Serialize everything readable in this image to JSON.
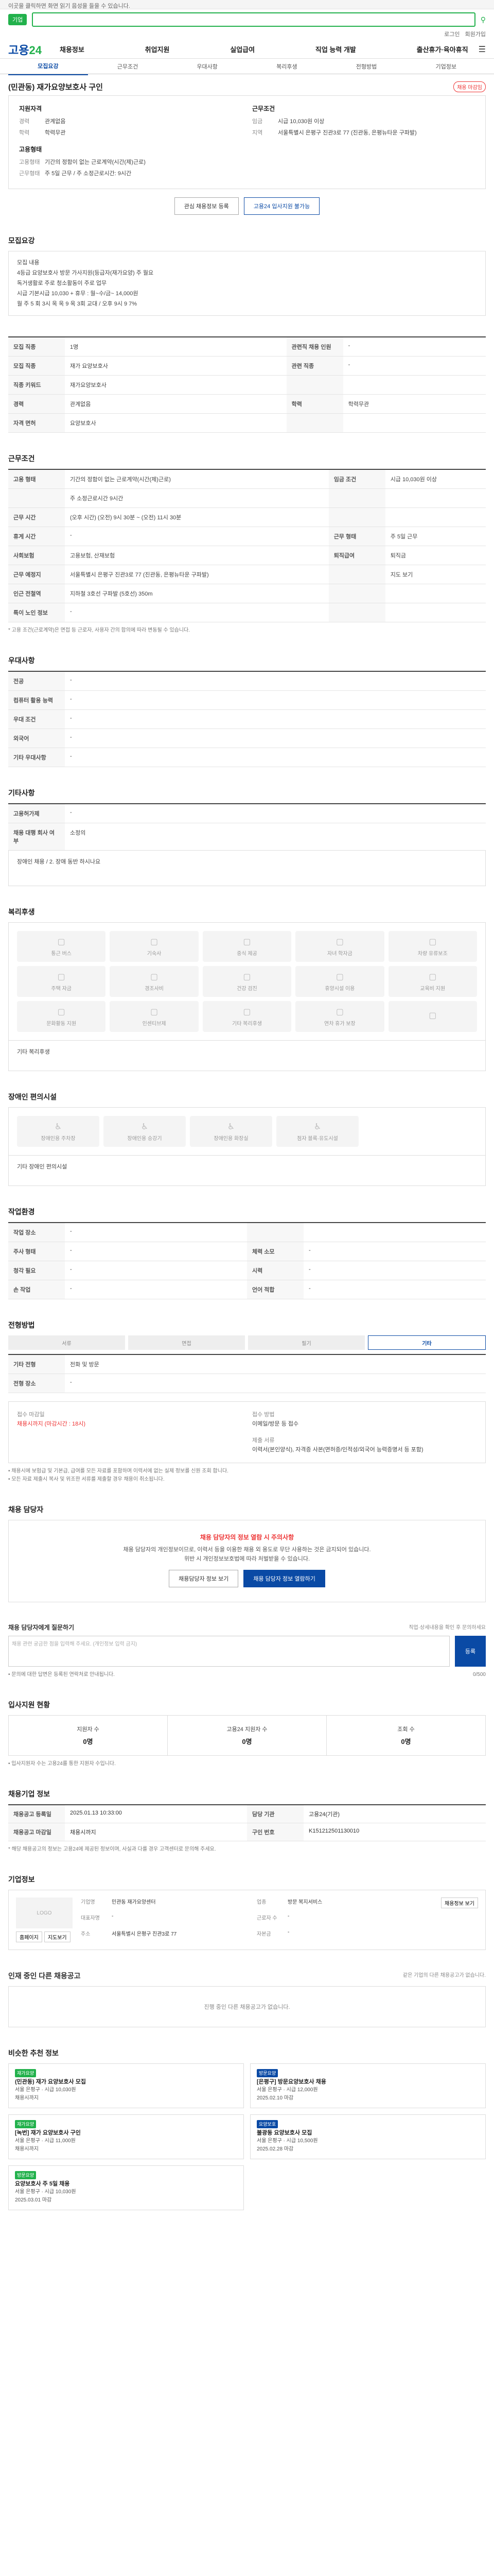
{
  "topbar": {
    "text": "이곳을 클릭하면 화면 읽기 음성을 들을 수 있습니다."
  },
  "search": {
    "filter": "기업"
  },
  "util": {
    "login": "로그인",
    "join": "회원가입"
  },
  "logo": {
    "part1": "고용",
    "part2": "24"
  },
  "gnb": [
    "채용정보",
    "취업지원",
    "실업급여",
    "직업 능력 개발",
    "출산휴가·육아휴직"
  ],
  "tabs": [
    "모집요강",
    "근무조건",
    "우대사항",
    "복리후생",
    "전형방법",
    "기업정보"
  ],
  "job": {
    "title": "(민관동) 재가요양보호사 구인",
    "badge": "채용 마감임",
    "summary": {
      "recruit_head": "지원자격",
      "recruit": [
        {
          "k": "경력",
          "v": "관계없음"
        },
        {
          "k": "학력",
          "v": "학력무관"
        }
      ],
      "work_head": "근무조건",
      "work": [
        {
          "k": "임금",
          "v": "시급 10,030원 이상"
        },
        {
          "k": "지역",
          "v": "서울특별시 은평구 진관3로 77 (진관동, 은평뉴타운 구파발)"
        }
      ],
      "emp_head": "고용형태",
      "emp": [
        {
          "k": "고용형태",
          "v": "기간의 정함이 없는 근로계약(시간(제)근로)"
        },
        {
          "k": "근무형태",
          "v": "주 5일 근무 / 주 소정근로시간: 9시간"
        }
      ]
    },
    "btn_scrap": "관심 채용정보 등록",
    "btn_apply": "고용24 입사지원 불가능"
  },
  "recruit_section": {
    "title": "모집요강",
    "desc_lines": [
      "모집 내용",
      "4등급 요양보호사 방문 가사지원(등급자(재가요양) 주 월요",
      "독거생활로 주로 청소활동이 주로 업무",
      "시급 기본시급 10,030 + 휴무 : 월~수/금~ 14,000원",
      "월 주 5 회 3시 옥 옥 9 옥 3회 교대 / 오후 9시 9 7%"
    ],
    "rows": [
      [
        {
          "k": "모집 직종",
          "v": "1명"
        },
        {
          "k": "관련직 채용 인원",
          "v": "-"
        }
      ],
      [
        {
          "k": "모집 직종",
          "v": "재가 요양보호사"
        },
        {
          "k": "관련 직종",
          "v": "-"
        }
      ],
      [
        {
          "k": "직종 키워드",
          "v": "재가요양보호사"
        },
        {
          "k": "",
          "v": ""
        }
      ],
      [
        {
          "k": "경력",
          "v": "관계없음"
        },
        {
          "k": "학력",
          "v": "학력무관"
        }
      ],
      [
        {
          "k": "자격 면허",
          "v": "요양보호사"
        },
        {
          "k": "",
          "v": ""
        }
      ]
    ]
  },
  "work_section": {
    "title": "근무조건",
    "rows": [
      [
        {
          "k": "고용 형태",
          "v": "기간의 정함이 없는 근로계약(시간(제)근로)"
        },
        {
          "k": "임금 조건",
          "v": "시급 10,030원 이상"
        }
      ],
      [
        {
          "k": "",
          "v": "주 소정근로시간 9시간"
        },
        {
          "k": "",
          "v": ""
        }
      ],
      [
        {
          "k": "근무 시간",
          "v": "(오후 시간) (오전) 9시 30분 ~ (오전) 11시 30분"
        },
        {
          "k": "",
          "v": ""
        }
      ],
      [
        {
          "k": "휴게 시간",
          "v": "-"
        },
        {
          "k": "근무 형태",
          "v": "주 5일 근무"
        }
      ],
      [
        {
          "k": "사회보험",
          "v": "고용보험, 산재보험"
        },
        {
          "k": "퇴직급여",
          "v": "퇴직금"
        }
      ],
      [
        {
          "k": "근무 예정지",
          "v": "서울특별시 은평구 진관3로 77 (진관동, 은평뉴타운 구파발)"
        },
        {
          "k": "",
          "v": "지도 보기"
        }
      ],
      [
        {
          "k": "인근 전철역",
          "v": "지하철 3호선 구파발 (5호선) 350m"
        },
        {
          "k": "",
          "v": ""
        }
      ],
      [
        {
          "k": "특이 노인 정보",
          "v": "-"
        },
        {
          "k": "",
          "v": ""
        }
      ]
    ],
    "note": "* 고용 조건(근로계약)은 면접 등 근로자, 사용자 간의 합의에 따라 변동될 수 있습니다."
  },
  "pref_section": {
    "title": "우대사항",
    "rows": [
      {
        "k": "전공",
        "v": "-"
      },
      {
        "k": "컴퓨터 활용 능력",
        "v": "-"
      },
      {
        "k": "우대 조건",
        "v": "-"
      },
      {
        "k": "외국어",
        "v": "-"
      },
      {
        "k": "기타 우대사항",
        "v": "-"
      }
    ]
  },
  "other_section": {
    "title": "기타사항",
    "rows": [
      {
        "k": "고용허가제",
        "v": "-"
      },
      {
        "k": "채용 대행 회사 여부",
        "v": "소정의"
      }
    ],
    "sub": "장애인 채용 / 2. 장애 동반 하시나요"
  },
  "welfare_section": {
    "title": "복리후생",
    "items": [
      "통근 버스",
      "기숙사",
      "중식 제공",
      "자녀 학자금",
      "차량 유류보조",
      "주택 자금",
      "경조사비",
      "건강 검진",
      "휴양시설 이용",
      "교육비 지원",
      "문화활동 지원",
      "인센티브제",
      "기타 복리후생",
      "연차 휴가 보장",
      ""
    ],
    "etc": "기타 복리후생"
  },
  "disabled_section": {
    "title": "장애인 편의시설",
    "items": [
      "장애인용 주차장",
      "장애인용 승강기",
      "장애인용 화장실",
      "점자 블록·유도시설"
    ],
    "etc": "기타 장애인 편의시설"
  },
  "env_section": {
    "title": "작업환경",
    "rows": [
      [
        {
          "k": "작업 장소",
          "v": "-"
        },
        {
          "k": "",
          "v": ""
        }
      ],
      [
        {
          "k": "주사 형태",
          "v": "-"
        },
        {
          "k": "체력 소모",
          "v": "-"
        }
      ],
      [
        {
          "k": "청각 필요",
          "v": "-"
        },
        {
          "k": "시력",
          "v": "-"
        }
      ],
      [
        {
          "k": "손 작업",
          "v": "-"
        },
        {
          "k": "언어 적합",
          "v": "-"
        }
      ]
    ]
  },
  "process_section": {
    "title": "전형방법",
    "steps": [
      "서류",
      "면접",
      "필기",
      "기타"
    ],
    "rows": [
      {
        "k": "기타 전형",
        "v": "전화 및 방문"
      },
      {
        "k": "전형 장소",
        "v": "-"
      }
    ],
    "apply": {
      "head1": "접수 마감일",
      "val1": "채용시까지 (마감시간 : 18시)",
      "head2": "접수 방법",
      "val2": "이메일/방문 등 접수",
      "head3": "제출 서류",
      "val3": "이력서(본인양식), 자격증 사본(면허증/인적성/외국어 능력증명서 등 포함)"
    },
    "notes": [
      "• 채용시에 보험급 및 기본급, 급여를 모든 자료를 포함하며 이력서에 없는 실제 정보를 신원 조회 합니다.",
      "• 모든 자료 제출시 복사 및 위조한 서류를 제출할 경우 채용이 취소됩니다."
    ]
  },
  "contact_section": {
    "title": "채용 담당자",
    "notice_title": "채용 담당자의 정보 열람 시 주의사항",
    "notice_lines": [
      "채용 담당자의 개인정보이므로, 이력서 등을 이용한 채용 외 용도로 무단 사용하는 것은 금지되어 있습니다.",
      "위반 시 개인정보보호법에 따라 처벌받을 수 있습니다."
    ],
    "btn_detail": "채용담당자 정보 보기",
    "btn_view": "채용 담당자 정보 열람하기"
  },
  "qna_section": {
    "title": "채용 담당자에게 질문하기",
    "hint": "직업·상세내용을 확인 후 문의하세요",
    "placeholder": "채용 관련 궁금한 점을 입력해 주세요. (개인정보 입력 금지)",
    "submit": "등록",
    "note": "• 문의에 대한 답변은 등록된 연락처로 안내됩니다.",
    "count": "0/500"
  },
  "stats_section": {
    "title": "입사지원 현황",
    "items": [
      {
        "label": "지원자 수",
        "num": "0명"
      },
      {
        "label": "고용24 지원자 수",
        "num": "0명"
      },
      {
        "label": "조회 수",
        "num": "0명"
      }
    ],
    "note": "• 입사지원자 수는 고용24를 통한 지원자 수입니다."
  },
  "job_info_section": {
    "title": "채용기업 정보",
    "rows": [
      [
        {
          "k": "채용공고 등록일",
          "v": "2025.01.13 10:33:00"
        },
        {
          "k": "담당 기관",
          "v": "고용24(기관)"
        }
      ],
      [
        {
          "k": "채용공고 마감일",
          "v": "채용시까지"
        },
        {
          "k": "구인 번호",
          "v": "K151212501130010"
        }
      ]
    ],
    "note": "* 해당 채용공고의 정보는 고용24에 제공된 정보이며, 사실과 다를 경우 고객센터로 문의해 주세요."
  },
  "company_section": {
    "title": "기업정보",
    "logo": "LOGO",
    "fields": [
      {
        "k": "기업명",
        "v": "민관동 재가요양센터"
      },
      {
        "k": "업종",
        "v": "방문 복지서비스"
      },
      {
        "k": "대표자명",
        "v": "-"
      },
      {
        "k": "근로자 수",
        "v": "-"
      },
      {
        "k": "주소",
        "v": "서울특별시 은평구 진관3로 77"
      },
      {
        "k": "자본금",
        "v": "-"
      }
    ],
    "btn_home": "홈페이지",
    "btn_map": "지도보기",
    "btn_apply": "채용정보 보기"
  },
  "related_section": {
    "title": "인재 중인 다른 채용공고",
    "more": "같은 기업의 다른 채용공고가 없습니다.",
    "empty": "진행 중인 다른 채용공고가 없습니다."
  },
  "recommend_section": {
    "title": "비슷한 추천 정보",
    "cards": [
      {
        "tag": "재가요양",
        "title": "(민관동) 재가 요양보호사 모집",
        "line2": "서울 은평구 · 시급 10,030원",
        "line3": "채용시까지"
      },
      {
        "tag": "방문요양",
        "title": "[은평구] 방문요양보호사 채용",
        "line2": "서울 은평구 · 시급 12,000원",
        "line3": "2025.02.10 마감"
      },
      {
        "tag": "재가요양",
        "title": "[녹번] 재가 요양보호사 구인",
        "line2": "서울 은평구 · 시급 11,000원",
        "line3": "채용시까지"
      },
      {
        "tag": "요양보호",
        "title": "불광동 요양보호사 모집",
        "line2": "서울 은평구 · 시급 10,500원",
        "line3": "2025.02.28 마감"
      },
      {
        "tag": "방문요양",
        "title": "요양보호사 주 5일 채용",
        "line2": "서울 은평구 · 시급 10,030원",
        "line3": "2025.03.01 마감"
      }
    ]
  }
}
